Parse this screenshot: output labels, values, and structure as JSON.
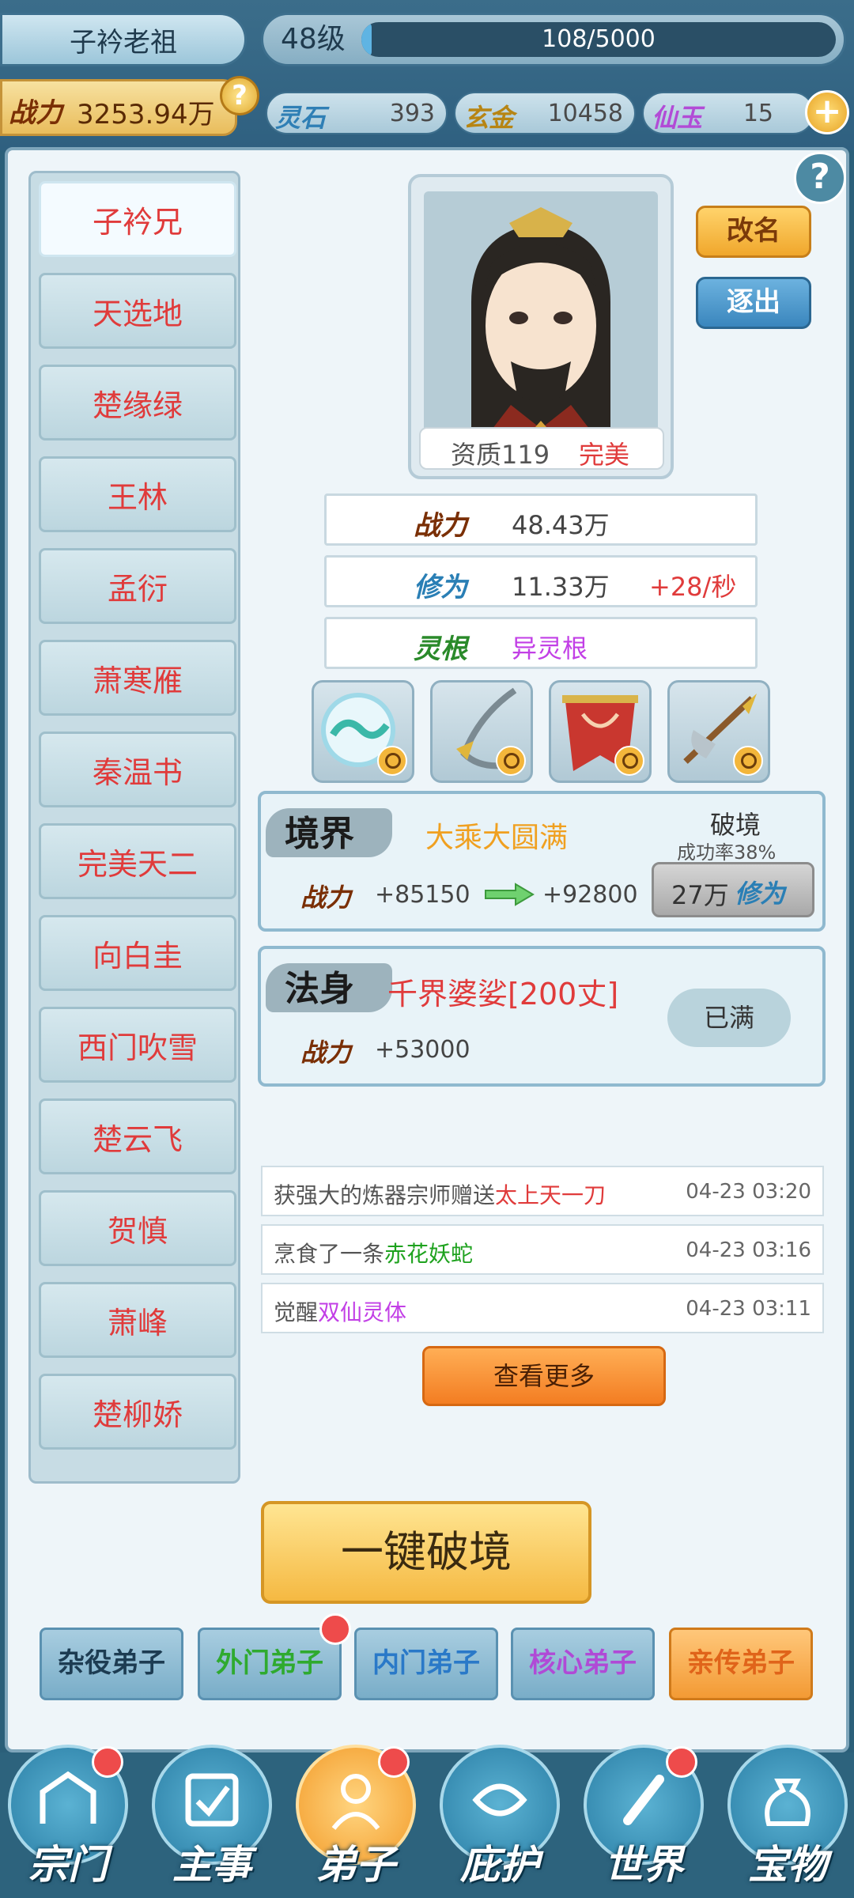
{
  "header": {
    "player_name": "子衿老祖",
    "level": "48级",
    "exp_text": "108/5000",
    "exp_fraction": 0.0216,
    "power_label": "战力",
    "power_value": "3253.94万",
    "help_symbol": "?",
    "resources": [
      {
        "label": "灵石",
        "value": "393",
        "color": "#2f7fb5"
      },
      {
        "label": "玄金",
        "value": "10458",
        "color": "#b78514"
      },
      {
        "label": "仙玉",
        "value": "15",
        "color": "#b24bd6"
      }
    ],
    "plus_symbol": "+"
  },
  "disciple_list": [
    "子衿兄",
    "天选地",
    "楚缘绿",
    "王林",
    "孟衍",
    "萧寒雁",
    "秦温书",
    "完美天二",
    "向白圭",
    "西门吹雪",
    "楚云飞",
    "贺慎",
    "萧峰",
    "楚柳娇"
  ],
  "character": {
    "quality_label": "资质119",
    "quality_rank": "完美",
    "rename_label": "改名",
    "expel_label": "逐出",
    "help_symbol": "?",
    "stats": {
      "power_label": "战力",
      "power_value": "48.43万",
      "cultivation_label": "修为",
      "cultivation_value": "11.33万",
      "cultivation_rate": "+28/秒",
      "root_label": "灵根",
      "root_value": "异灵根"
    }
  },
  "equipment": [
    "orb-icon",
    "hook-blade-icon",
    "banner-icon",
    "axe-icon"
  ],
  "realm": {
    "title": "境界",
    "name": "大乘大圆满",
    "power_label": "战力",
    "power_current": "+85150",
    "power_next": "+92800",
    "breakthrough_title": "破境",
    "success_rate": "成功率38%",
    "cost_value": "27万",
    "cost_unit": "修为"
  },
  "dharma_body": {
    "title": "法身",
    "name": "千界婆娑[200丈]",
    "power_label": "战力",
    "power_value": "+53000",
    "status": "已满"
  },
  "logs": [
    {
      "prefix": "获强大的炼器宗师赠送",
      "highlight": "太上天一刀",
      "time": "04-23 03:20"
    },
    {
      "prefix": "烹食了一条",
      "highlight": "赤花妖蛇",
      "time": "04-23 03:16"
    },
    {
      "prefix": "觉醒",
      "highlight": "双仙灵体",
      "time": "04-23 03:11"
    }
  ],
  "see_more_label": "查看更多",
  "one_key_label": "一键破境",
  "tabs": [
    {
      "label": "杂役弟子",
      "color": "#1d3c52"
    },
    {
      "label": "外门弟子",
      "color": "#2faa2f"
    },
    {
      "label": "内门弟子",
      "color": "#2a79c8"
    },
    {
      "label": "核心弟子",
      "color": "#b04ad6"
    },
    {
      "label": "亲传弟子",
      "color": "#e0641a"
    }
  ],
  "nav": [
    "宗门",
    "主事",
    "弟子",
    "庇护",
    "世界",
    "宝物"
  ]
}
